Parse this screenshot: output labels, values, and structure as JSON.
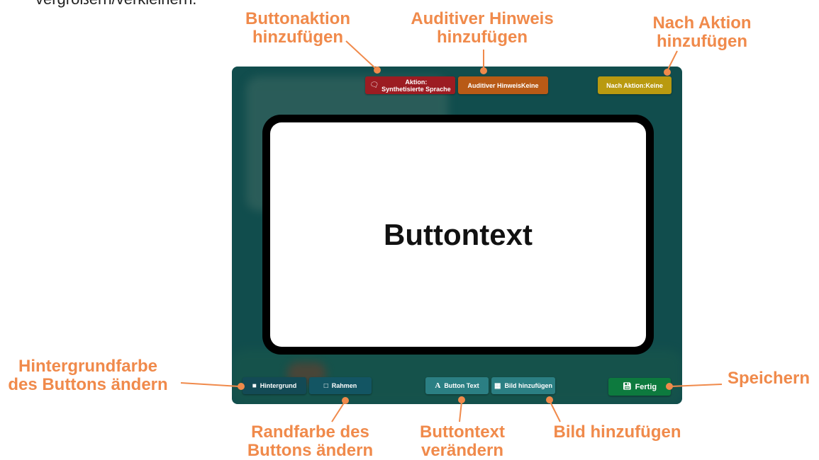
{
  "intro_text": "vergrößern/verkleinern.",
  "top_bar": {
    "action_label": "Aktion:",
    "action_value": "Synthetisierte Sprache",
    "action_icon": "speech-bubble-icon",
    "audio_hint_label": "Auditiver HinweisKeine",
    "after_action_label": "Nach Aktion:Keine"
  },
  "preview": {
    "button_text": "Buttontext"
  },
  "bottom_bar": {
    "background_label": "Hintergrund",
    "border_label": "Rahmen",
    "button_text_label": "Button Text",
    "add_image_label": "Bild hinzufügen",
    "done_label": "Fertig"
  },
  "callouts": {
    "button_action": [
      "Buttonaktion",
      "hinzufügen"
    ],
    "audio_hint": [
      "Auditiver Hinweis",
      "hinzufügen"
    ],
    "after_action": [
      "Nach Aktion",
      "hinzufügen"
    ],
    "background_color": [
      "Hintergrundfarbe",
      "des Buttons ändern"
    ],
    "save": [
      "Speichern"
    ],
    "border_color": [
      "Randfarbe des",
      "Buttons ändern"
    ],
    "change_text": [
      "Buttontext",
      "verändern"
    ],
    "add_image": [
      "Bild hinzufügen"
    ]
  },
  "colors": {
    "panel": "#114d4d",
    "action_chip": "#9c1c22",
    "audio_chip": "#b85a16",
    "after_chip": "#b99a10",
    "background_btn": "#134a55",
    "border_btn": "#135563",
    "text_btn": "#2b7f83",
    "image_btn": "#2b7f83",
    "done_btn": "#0d7a3e",
    "callout": "#f08a4b"
  }
}
